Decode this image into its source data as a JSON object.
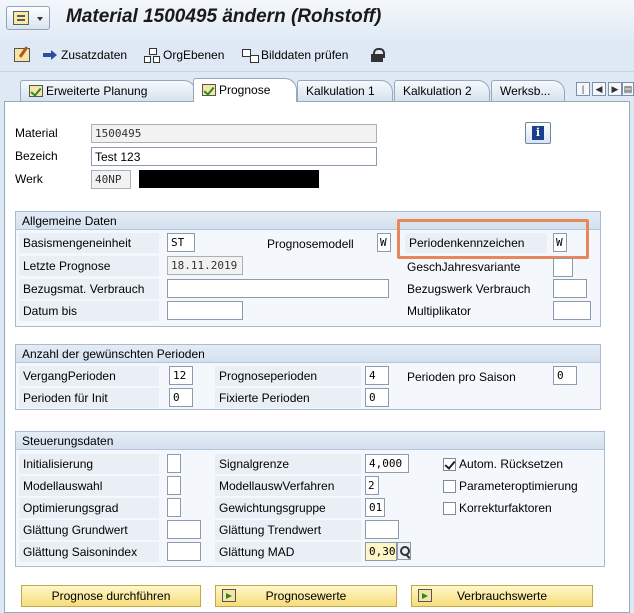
{
  "window": {
    "title": "Material 1500495 ändern (Rohstoff)"
  },
  "toolbar": {
    "zusatzdaten": "Zusatzdaten",
    "orgebenen": "OrgEbenen",
    "bilddaten": "Bilddaten prüfen"
  },
  "tabs": [
    {
      "label": "Erweiterte Planung",
      "checked": true
    },
    {
      "label": "Prognose",
      "checked": true
    },
    {
      "label": "Kalkulation 1",
      "checked": false
    },
    {
      "label": "Kalkulation 2",
      "checked": false
    },
    {
      "label": "Werksb...",
      "checked": false
    }
  ],
  "header": {
    "material_label": "Material",
    "material_value": "1500495",
    "bezeich_label": "Bezeich",
    "bezeich_value": "Test 123",
    "werk_label": "Werk",
    "werk_value": "40NP"
  },
  "allgemein": {
    "title": "Allgemeine Daten",
    "basismenge_label": "Basismengeneinheit",
    "basismenge_value": "ST",
    "prognosemodell_label": "Prognosemodell",
    "prognosemodell_value": "W",
    "periodenkennzeichen_label": "Periodenkennzeichen",
    "periodenkennzeichen_value": "W",
    "letzte_prognose_label": "Letzte Prognose",
    "letzte_prognose_value": "18.11.2019",
    "geschjahr_label": "GeschJahresvariante",
    "geschjahr_value": "",
    "bezugsmat_label": "Bezugsmat. Verbrauch",
    "bezugsmat_value": "",
    "bezugswerk_label": "Bezugswerk Verbrauch",
    "bezugswerk_value": "",
    "datum_bis_label": "Datum bis",
    "datum_bis_value": "",
    "multiplikator_label": "Multiplikator",
    "multiplikator_value": ""
  },
  "perioden": {
    "title": "Anzahl der gewünschten Perioden",
    "vergang_label": "VergangPerioden",
    "vergang_value": "12",
    "prognoseperioden_label": "Prognoseperioden",
    "prognoseperioden_value": "4",
    "saison_label": "Perioden pro Saison",
    "saison_value": "0",
    "init_label": "Perioden für Init",
    "init_value": "0",
    "fixiert_label": "Fixierte Perioden",
    "fixiert_value": "0"
  },
  "steuerung": {
    "title": "Steuerungsdaten",
    "initialisierung_label": "Initialisierung",
    "modellauswahl_label": "Modellauswahl",
    "optimierungsgrad_label": "Optimierungsgrad",
    "glaettung_grundwert_label": "Glättung Grundwert",
    "glaettung_saison_label": "Glättung Saisonindex",
    "signalgrenze_label": "Signalgrenze",
    "signalgrenze_value": "4,000",
    "modellausw_verfahren_label": "ModellauswVerfahren",
    "modellausw_verfahren_value": "2",
    "gewichtungsgruppe_label": "Gewichtungsgruppe",
    "gewichtungsgruppe_value": "01",
    "glaettung_trend_label": "Glättung Trendwert",
    "glaettung_trend_value": "",
    "glaettung_mad_label": "Glättung MAD",
    "glaettung_mad_value": "0,30",
    "autom_ruecksetzen_label": "Autom. Rücksetzen",
    "autom_ruecksetzen_checked": true,
    "parameteroptimierung_label": "Parameteroptimierung",
    "parameteroptimierung_checked": false,
    "korrekturfaktoren_label": "Korrekturfaktoren",
    "korrekturfaktoren_checked": false
  },
  "buttons": {
    "prognose_durchfuehren": "Prognose durchführen",
    "prognosewerte": "Prognosewerte",
    "verbrauchswerte": "Verbrauchswerte"
  },
  "colors": {
    "highlight": "#e8875a",
    "button_bg": "#f6dd7a",
    "background": "#dfe9f5"
  }
}
